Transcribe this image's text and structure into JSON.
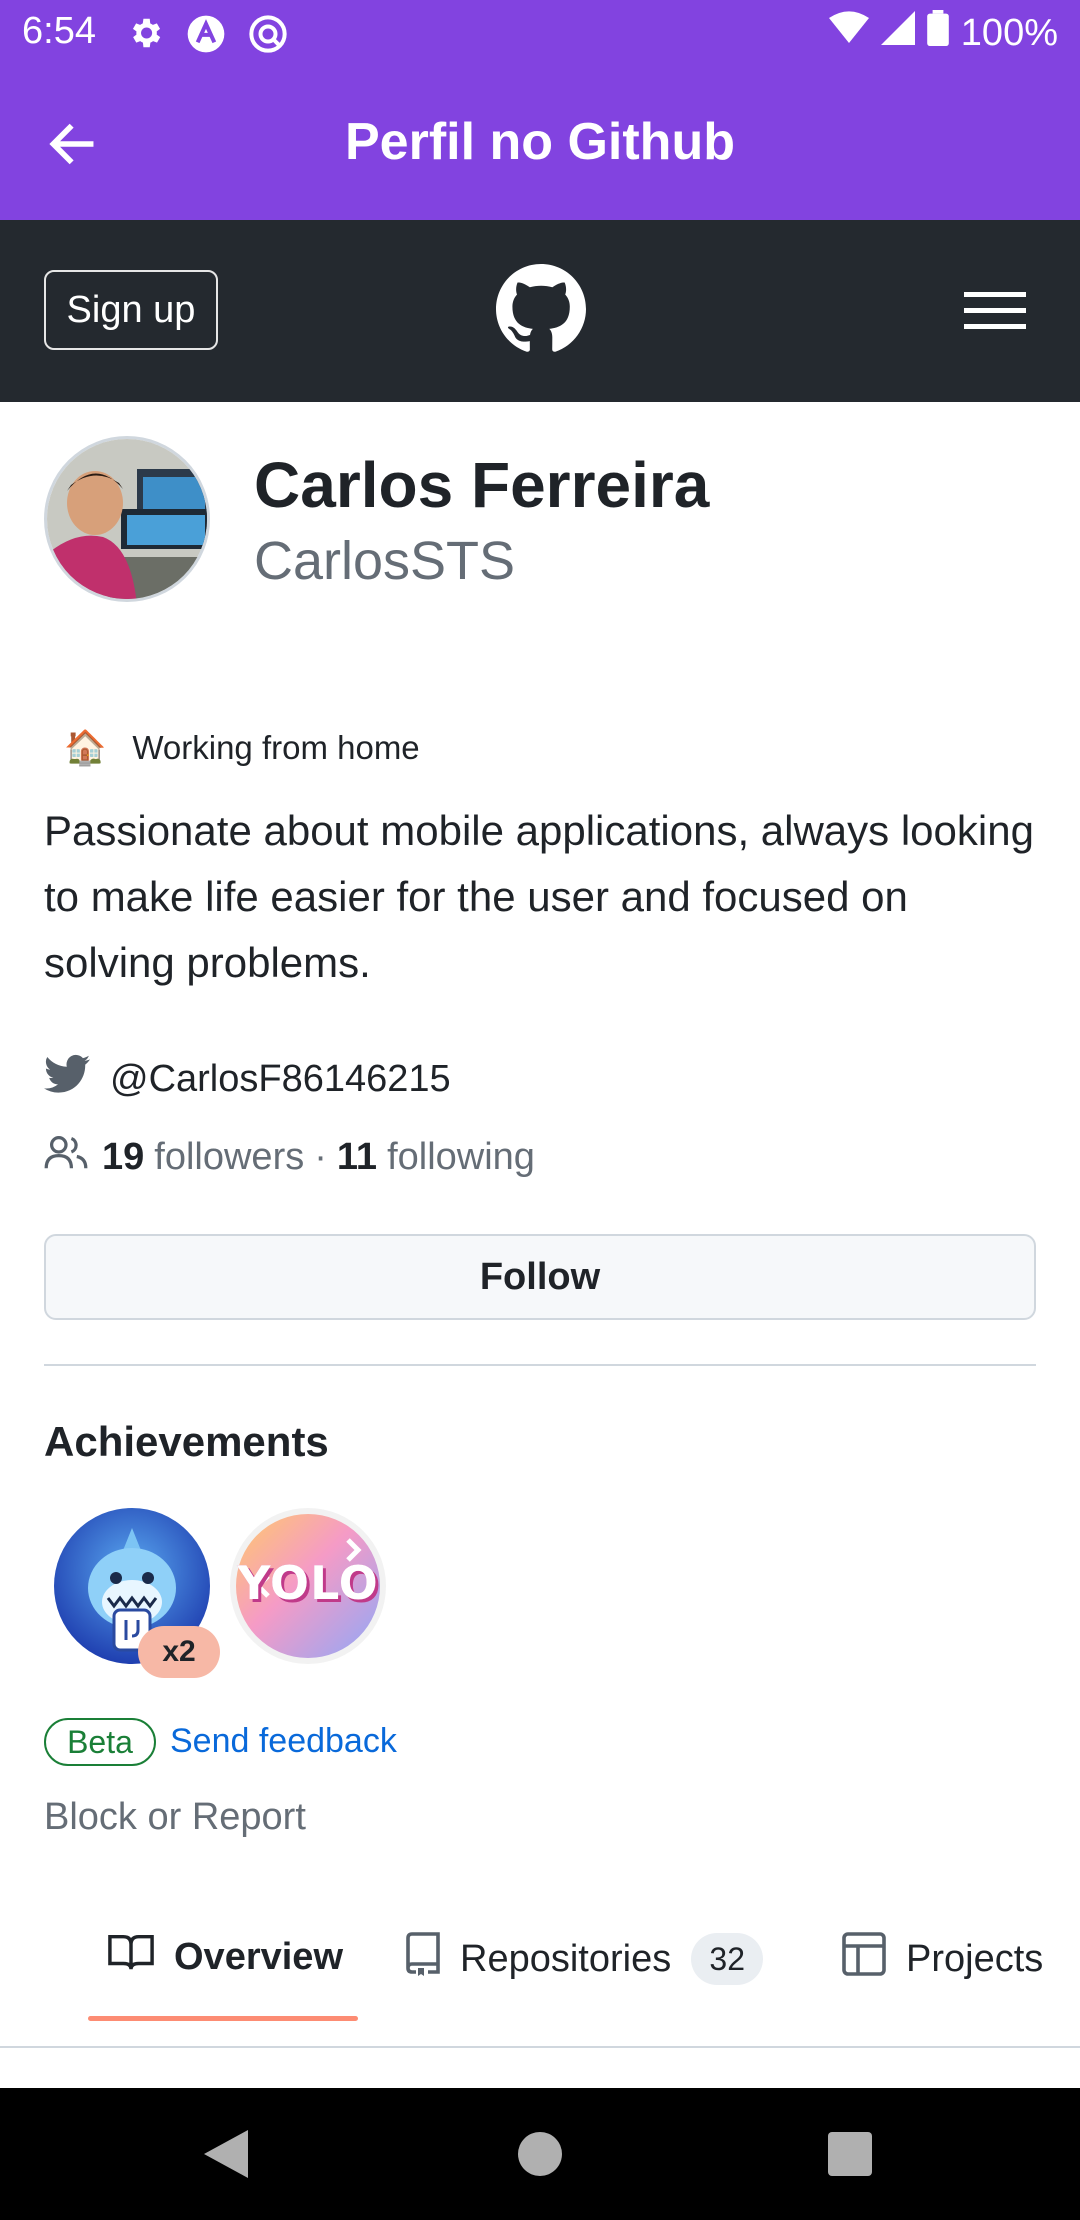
{
  "status_bar": {
    "time": "6:54",
    "battery": "100%"
  },
  "app_bar": {
    "title": "Perfil no Github"
  },
  "github_header": {
    "signup_label": "Sign up"
  },
  "profile": {
    "name": "Carlos Ferreira",
    "login": "CarlosSTS",
    "status_emoji": "🏠",
    "status_text": "Working from home",
    "bio": "Passionate about mobile applications, always looking to make life easier for the user and focused on solving problems.",
    "twitter": "@CarlosF86146215",
    "followers_count": "19",
    "followers_label": "followers",
    "separator": "·",
    "following_count": "11",
    "following_label": "following",
    "follow_label": "Follow"
  },
  "achievements": {
    "title": "Achievements",
    "badge_multiplier": "x2",
    "yolo_text": "YOLO",
    "beta_label": "Beta",
    "feedback_label": "Send feedback",
    "block_label": "Block or Report"
  },
  "tabs": [
    {
      "label": "Overview",
      "active": true
    },
    {
      "label": "Repositories",
      "count": "32"
    },
    {
      "label": "Projects"
    }
  ],
  "colors": {
    "app_bar": "#8243e0",
    "github_header": "#24292f",
    "link": "#0969da",
    "beta": "#1a7f37",
    "tab_underline": "#fd8c73"
  }
}
